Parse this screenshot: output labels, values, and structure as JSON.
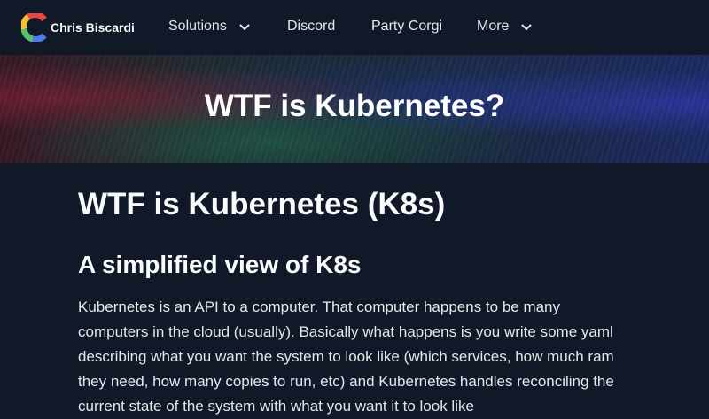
{
  "nav": {
    "brand": "Chris Biscardi",
    "items": [
      {
        "label": "Solutions"
      },
      {
        "label": "Discord"
      },
      {
        "label": "Party Corgi"
      },
      {
        "label": "More"
      }
    ]
  },
  "hero": {
    "title": "WTF is Kubernetes?"
  },
  "article": {
    "h1": "WTF is Kubernetes (K8s)",
    "h2": "A simplified view of K8s",
    "paragraph": "Kubernetes is an API to a computer. That computer happens to be many computers in the cloud (usually). Basically what happens is you write some yaml describing what you want the system to look like (which services, how much ram they need, how many copies to run, etc) and Kubernetes handles reconciling the current state of the system with what you want it to look like"
  },
  "colors": {
    "background": "#111827",
    "text": "#e5e7eb",
    "heading": "#f9fafb",
    "logo_red": "#e8473f",
    "logo_yellow": "#f2c12e",
    "logo_green": "#56c271",
    "logo_blue": "#4c7cf0"
  }
}
